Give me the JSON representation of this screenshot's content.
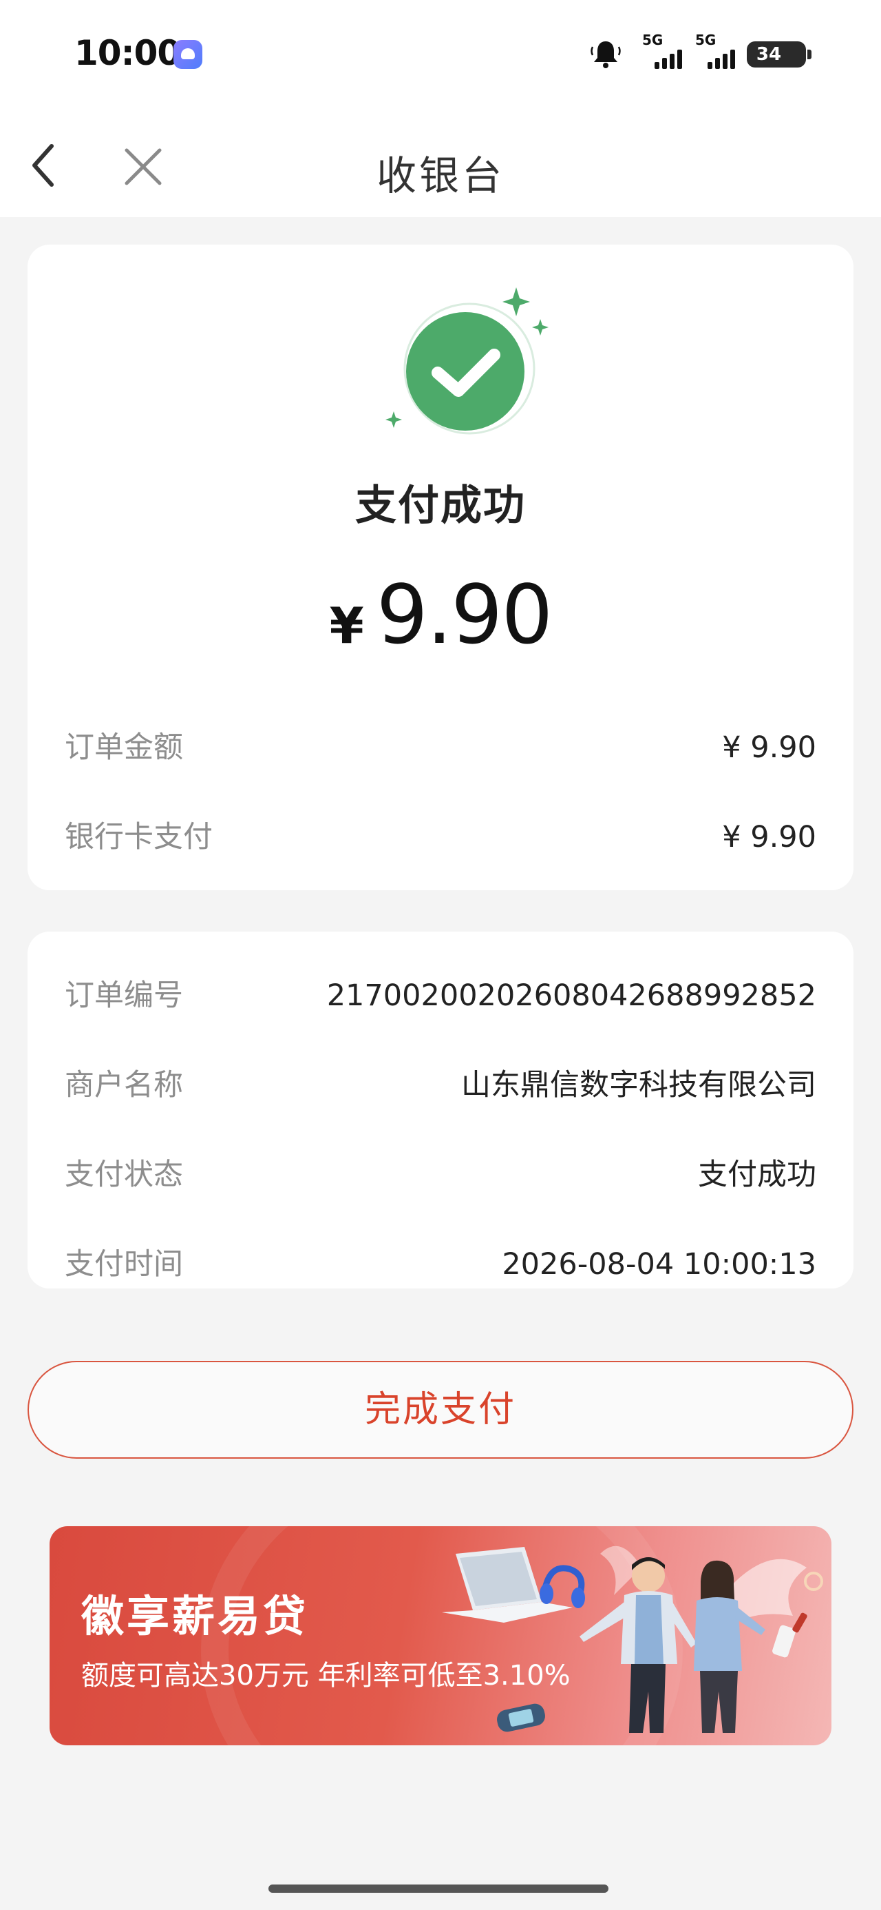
{
  "status_bar": {
    "time": "10:00",
    "network_1": "5G",
    "network_2": "5G",
    "battery": "34"
  },
  "nav": {
    "title": "收银台"
  },
  "payment": {
    "status_title": "支付成功",
    "currency": "¥",
    "amount": "9.90",
    "summary_rows": [
      {
        "label": "订单金额",
        "value": "¥ 9.90"
      },
      {
        "label": "银行卡支付",
        "value": "¥ 9.90"
      }
    ]
  },
  "details": {
    "rows": [
      {
        "label": "订单编号",
        "value": "21700200202608042688992852"
      },
      {
        "label": "商户名称",
        "value": "山东鼎信数字科技有限公司"
      },
      {
        "label": "支付状态",
        "value": "支付成功"
      },
      {
        "label": "支付时间",
        "value": "2026-08-04 10:00:13"
      }
    ]
  },
  "actions": {
    "done_label": "完成支付"
  },
  "banner": {
    "title": "徽享薪易贷",
    "subtitle": "额度可高达30万元  年利率可低至3.10%"
  },
  "colors": {
    "success_green": "#4daa6a",
    "accent_red": "#d9432b",
    "banner_red": "#d94a3e"
  },
  "icons": {
    "back": "chevron-left-icon",
    "close": "close-icon",
    "success": "check-circle-icon",
    "notification": "bell-icon"
  }
}
